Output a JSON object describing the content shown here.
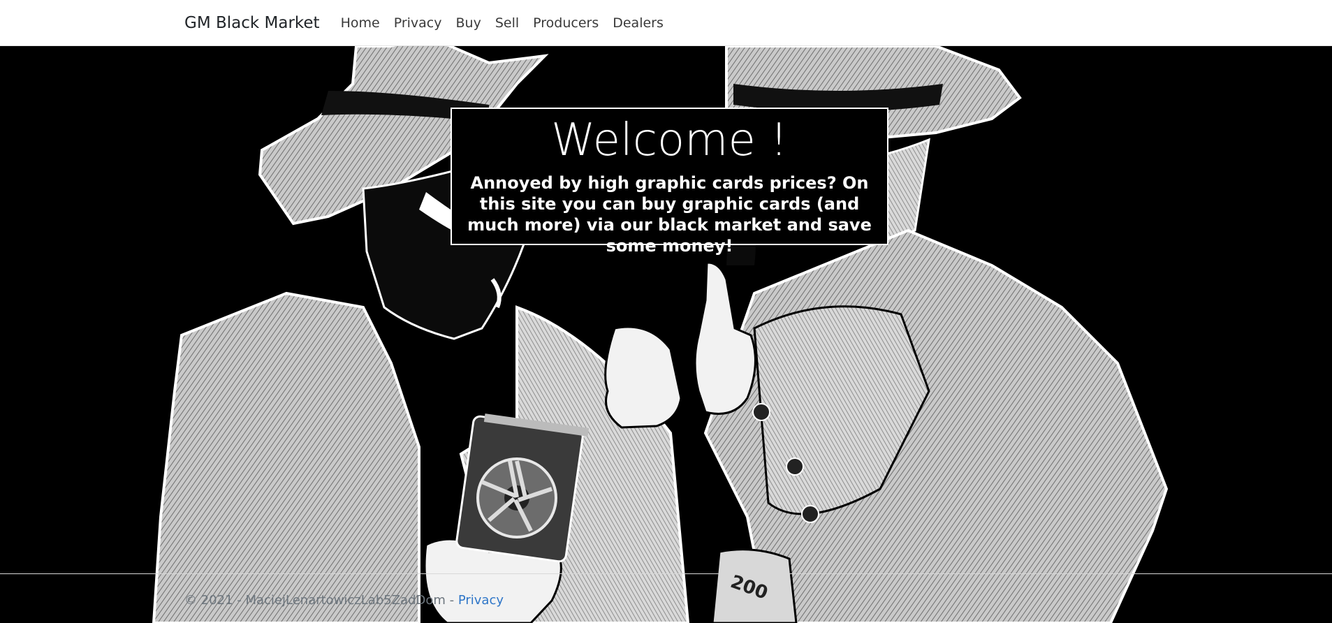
{
  "navbar": {
    "brand": "GM Black Market",
    "links": [
      "Home",
      "Privacy",
      "Buy",
      "Sell",
      "Producers",
      "Dealers"
    ]
  },
  "hero": {
    "title": "Welcome !",
    "text": "Annoyed by high graphic cards prices? On this site you can buy graphic cards (and much more) via our black market and save some money!",
    "banknote_text": "200"
  },
  "footer": {
    "copyright": "© 2021 - MaciejLenartowiczLab5ZadDom - ",
    "privacy_link": "Privacy"
  },
  "colors": {
    "nav_bg": "#ffffff",
    "hero_bg": "#000000",
    "link_blue": "#2f76c8",
    "footer_text": "#6c757d"
  }
}
